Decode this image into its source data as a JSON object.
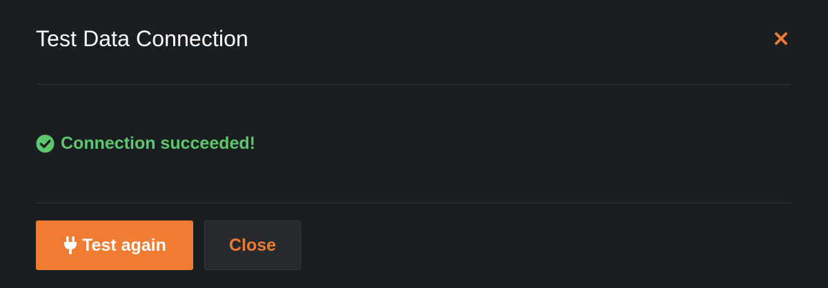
{
  "dialog": {
    "title": "Test Data Connection"
  },
  "status": {
    "icon": "check-circle-icon",
    "text": "Connection succeeded!"
  },
  "footer": {
    "test_again_label": "Test again",
    "test_again_icon": "plug-icon",
    "close_label": "Close"
  },
  "colors": {
    "accent": "#f07c33",
    "success": "#5ec76e",
    "background": "#1b1e21",
    "secondary_button": "#26292d"
  }
}
